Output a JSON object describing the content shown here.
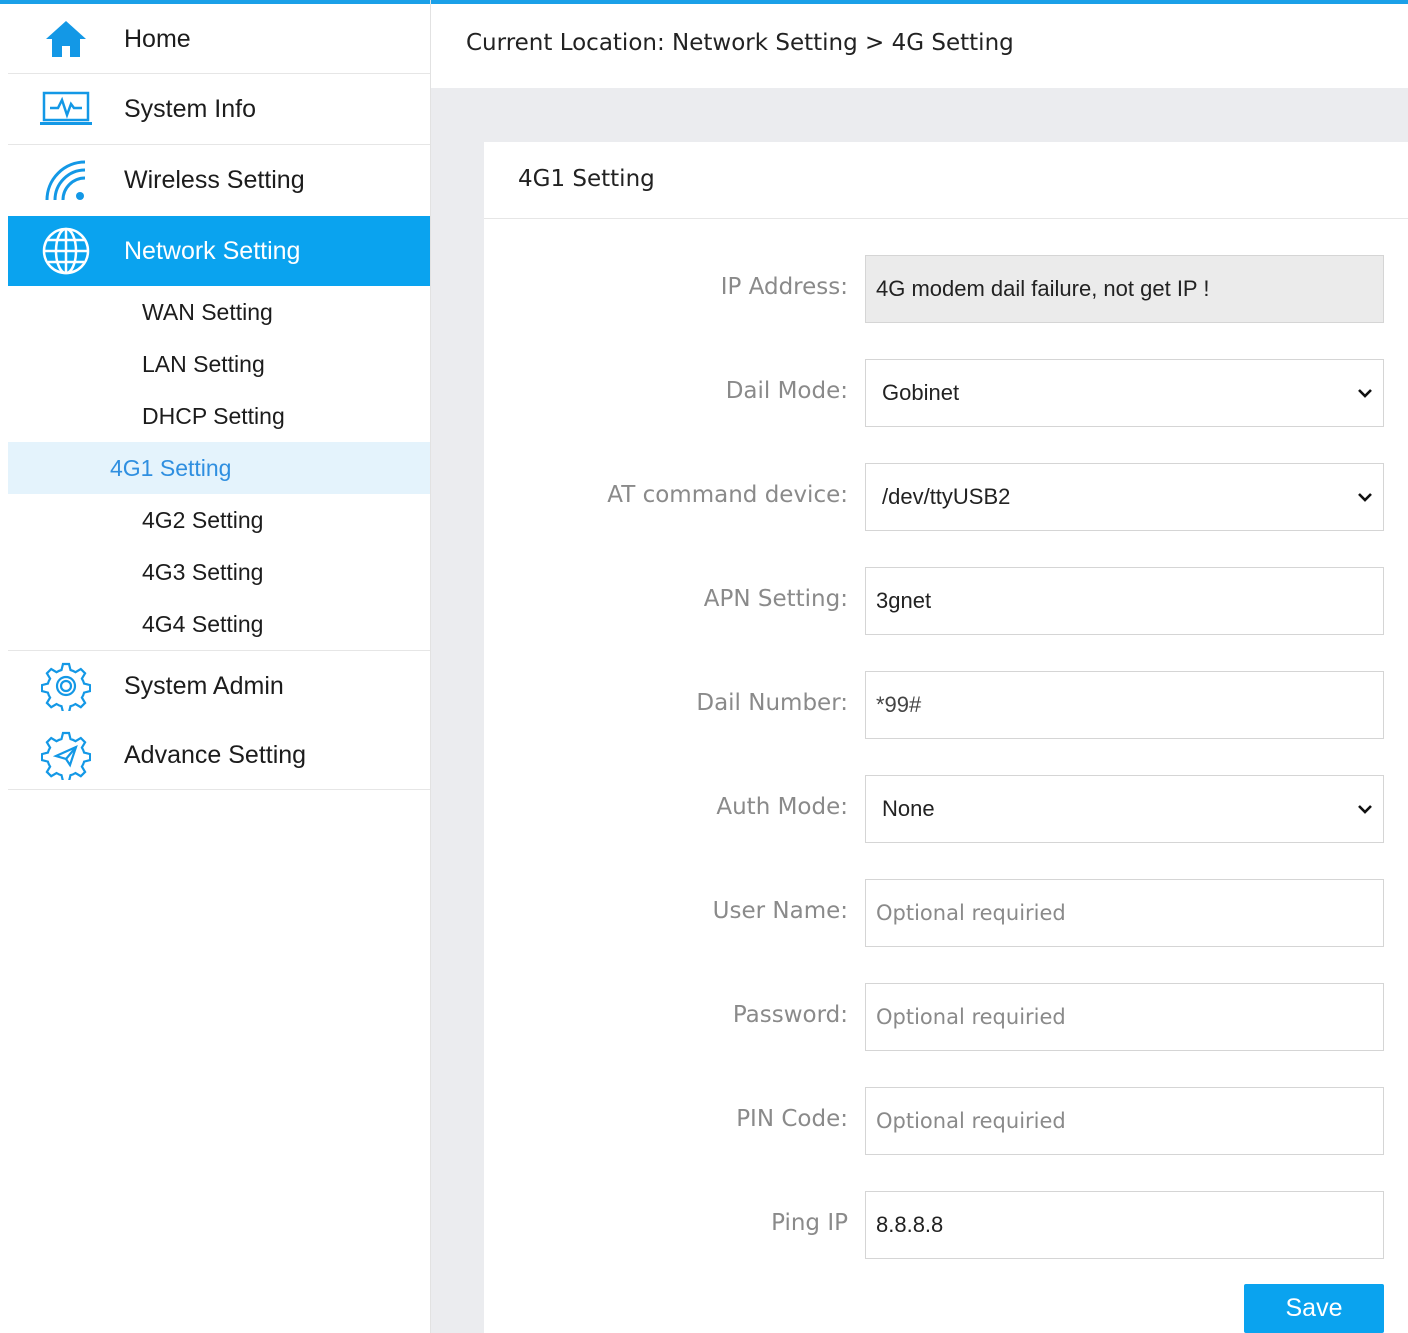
{
  "sidebar": {
    "home": "Home",
    "system_info": "System Info",
    "wireless_setting": "Wireless Setting",
    "network_setting": "Network Setting",
    "submenu": [
      "WAN Setting",
      "LAN Setting",
      "DHCP Setting",
      "4G1 Setting",
      "4G2 Setting",
      "4G3 Setting",
      "4G4 Setting"
    ],
    "system_admin": "System Admin",
    "advance_setting": "Advance Setting",
    "selected_submenu": "4G1 Setting"
  },
  "breadcrumb": "Current Location: Network Setting > 4G Setting",
  "panel": {
    "title": "4G1 Setting",
    "ip_address": {
      "label": "IP Address:",
      "value": "4G modem dail failure, not get IP !"
    },
    "dail_mode": {
      "label": "Dail Mode:",
      "value": "Gobinet"
    },
    "at_device": {
      "label": "AT command device:",
      "value": "/dev/ttyUSB2"
    },
    "apn": {
      "label": "APN Setting:",
      "value": "3gnet"
    },
    "dail_number": {
      "label": "Dail Number:",
      "value": "*99#"
    },
    "auth_mode": {
      "label": "Auth Mode:",
      "value": "None"
    },
    "user_name": {
      "label": "User Name:",
      "placeholder": "Optional requiried"
    },
    "password": {
      "label": "Password:",
      "placeholder": "Optional requiried"
    },
    "pin_code": {
      "label": "PIN Code:",
      "placeholder": "Optional requiried"
    },
    "ping_ip": {
      "label": "Ping IP",
      "value": "8.8.8.8"
    },
    "save": "Save"
  },
  "colors": {
    "accent": "#0aa3ef",
    "selected_bg": "#e4f3fc",
    "selected_text": "#2f8fe0",
    "content_bg": "#ebecef"
  }
}
